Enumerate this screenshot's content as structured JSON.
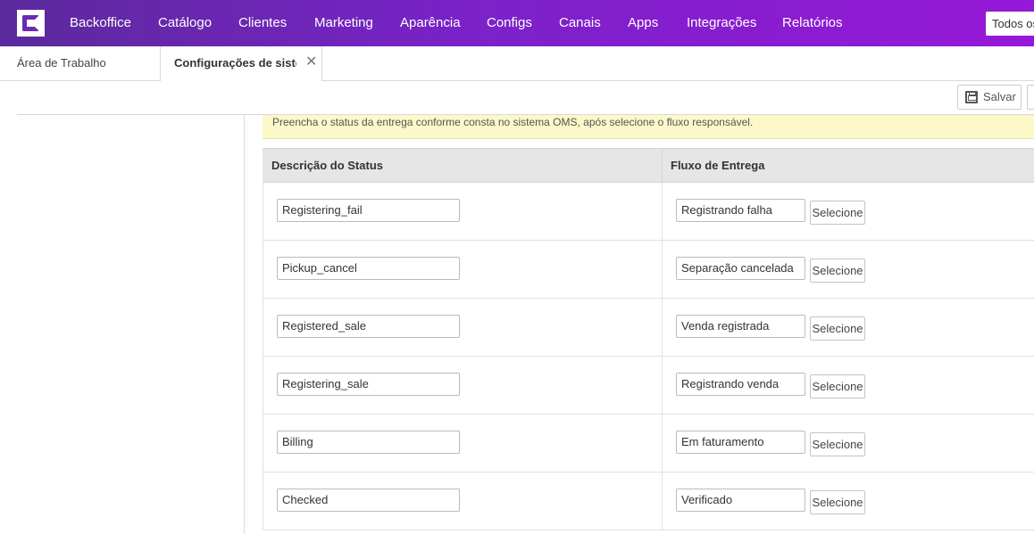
{
  "topbar": {
    "logo_icon": "c-logo-icon",
    "nav": [
      {
        "label": "Backoffice"
      },
      {
        "label": "Catálogo"
      },
      {
        "label": "Clientes"
      },
      {
        "label": "Marketing"
      },
      {
        "label": "Aparência"
      },
      {
        "label": "Configs"
      },
      {
        "label": "Canais"
      },
      {
        "label": "Apps"
      },
      {
        "label": "Integrações"
      },
      {
        "label": "Relatórios"
      }
    ],
    "search_value": "Todos os"
  },
  "tabs": {
    "workspace_label": "Área de Trabalho",
    "config_label": "Configurações de sistema",
    "close_glyph": "✕"
  },
  "toolbar": {
    "save_label": "Salvar",
    "save_icon": "floppy-disk-icon"
  },
  "notice": {
    "text": "Preencha o status da entrega conforme consta no sistema OMS, após selecione o fluxo responsável."
  },
  "table": {
    "headers": [
      "Descrição do Status",
      "Fluxo de Entrega"
    ],
    "select_label": "Selecione",
    "rows": [
      {
        "status": "Registering_fail",
        "flow": "Registrando falha"
      },
      {
        "status": "Pickup_cancel",
        "flow": "Separação cancelada"
      },
      {
        "status": "Registered_sale",
        "flow": "Venda registrada"
      },
      {
        "status": "Registering_sale",
        "flow": "Registrando venda"
      },
      {
        "status": "Billing",
        "flow": "Em faturamento"
      },
      {
        "status": "Checked",
        "flow": "Verificado"
      }
    ]
  },
  "colors": {
    "topbar_start": "#5b2a9c",
    "topbar_end": "#9618d8",
    "notice_bg": "#fcf8c8",
    "header_bg": "#e6e6e6"
  }
}
